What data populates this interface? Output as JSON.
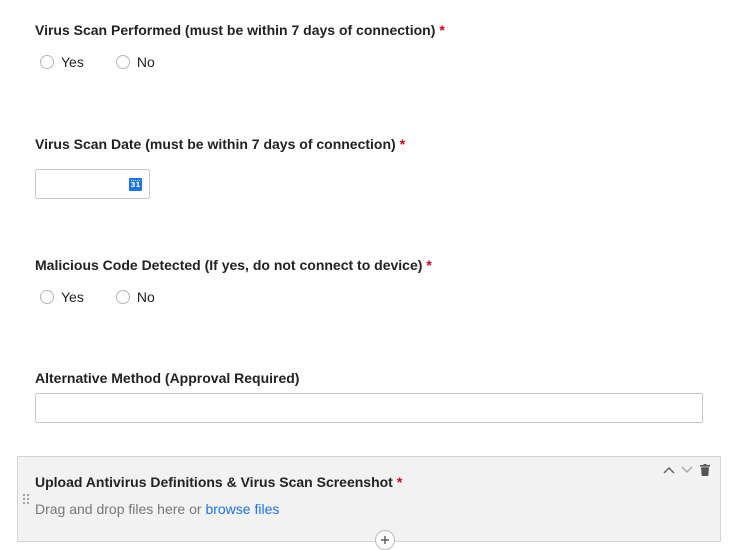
{
  "questions": {
    "virus_scan_performed": {
      "label": "Virus Scan Performed (must be within 7 days of connection)",
      "required_mark": "*",
      "options": [
        "Yes",
        "No"
      ]
    },
    "virus_scan_date": {
      "label": "Virus Scan Date (must be within 7 days of connection)",
      "required_mark": "*",
      "value": "",
      "calendar_day": "31"
    },
    "malicious_code": {
      "label": "Malicious Code Detected (If yes, do not connect to device)",
      "required_mark": "*",
      "options": [
        "Yes",
        "No"
      ]
    },
    "alternative_method": {
      "label": "Alternative Method (Approval Required)",
      "value": ""
    },
    "upload": {
      "label": "Upload Antivirus Definitions & Virus Scan Screenshot",
      "required_mark": "*",
      "hint_prefix": "Drag and drop files here or",
      "browse_link": "browse files"
    }
  },
  "icons": {
    "calendar": "calendar-icon",
    "move_up": "chevron-up-icon",
    "move_down": "chevron-down-icon",
    "delete": "trash-icon",
    "drag": "drag-handle-icon",
    "add": "plus-icon"
  },
  "colors": {
    "required": "#d0021b",
    "link": "#1a73e8",
    "panel_bg": "#f2f2f2",
    "border": "#c8c8c8"
  }
}
